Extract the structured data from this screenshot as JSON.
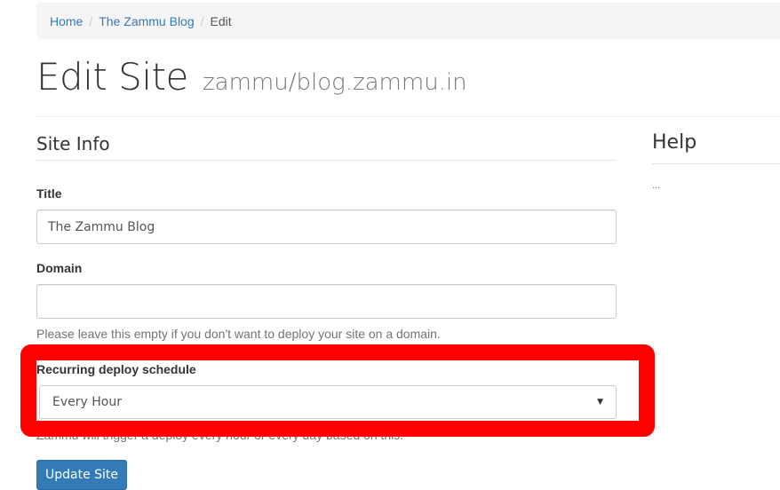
{
  "breadcrumb": {
    "items": [
      {
        "label": "Home"
      },
      {
        "label": "The Zammu Blog"
      },
      {
        "label": "Edit"
      }
    ],
    "separator": "/"
  },
  "page": {
    "title": "Edit Site",
    "subtitle": "zammu/blog.zammu.in"
  },
  "site_info": {
    "heading": "Site Info",
    "fields": {
      "title": {
        "label": "Title",
        "value": "The Zammu Blog"
      },
      "domain": {
        "label": "Domain",
        "value": "",
        "help": "Please leave this empty if you don't want to deploy your site on a domain."
      },
      "recurring": {
        "label": "Recurring deploy schedule",
        "selected": "Every Hour",
        "help": "Zammu will trigger a deploy every hour or every day based on this."
      }
    },
    "submit_label": "Update Site"
  },
  "help": {
    "heading": "Help",
    "text": "..."
  },
  "colors": {
    "link": "#337ab7",
    "primary_button": "#337ab7",
    "highlight": "#ff0000"
  },
  "icons": {
    "select_caret": "caret-down-icon"
  }
}
